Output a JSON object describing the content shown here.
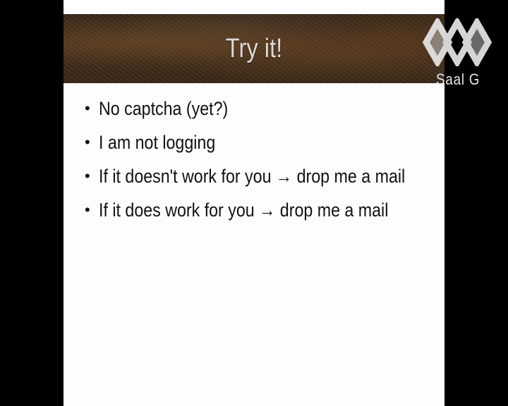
{
  "slide": {
    "title": "Try it!",
    "bullets": [
      "No captcha (yet?)",
      "I am not logging",
      "If it doesn't work for you → drop me a mail",
      "If it does work for you → drop me a mail"
    ]
  },
  "overlay": {
    "channel_label": "Saal G",
    "logo_icon": "ccc-chaos-logo-icon"
  },
  "colors": {
    "background": "#000000",
    "slide_background": "#fdfdfd",
    "title_text": "#d9d9d9",
    "body_text": "#111111",
    "title_bar": "#3f2e1e"
  }
}
